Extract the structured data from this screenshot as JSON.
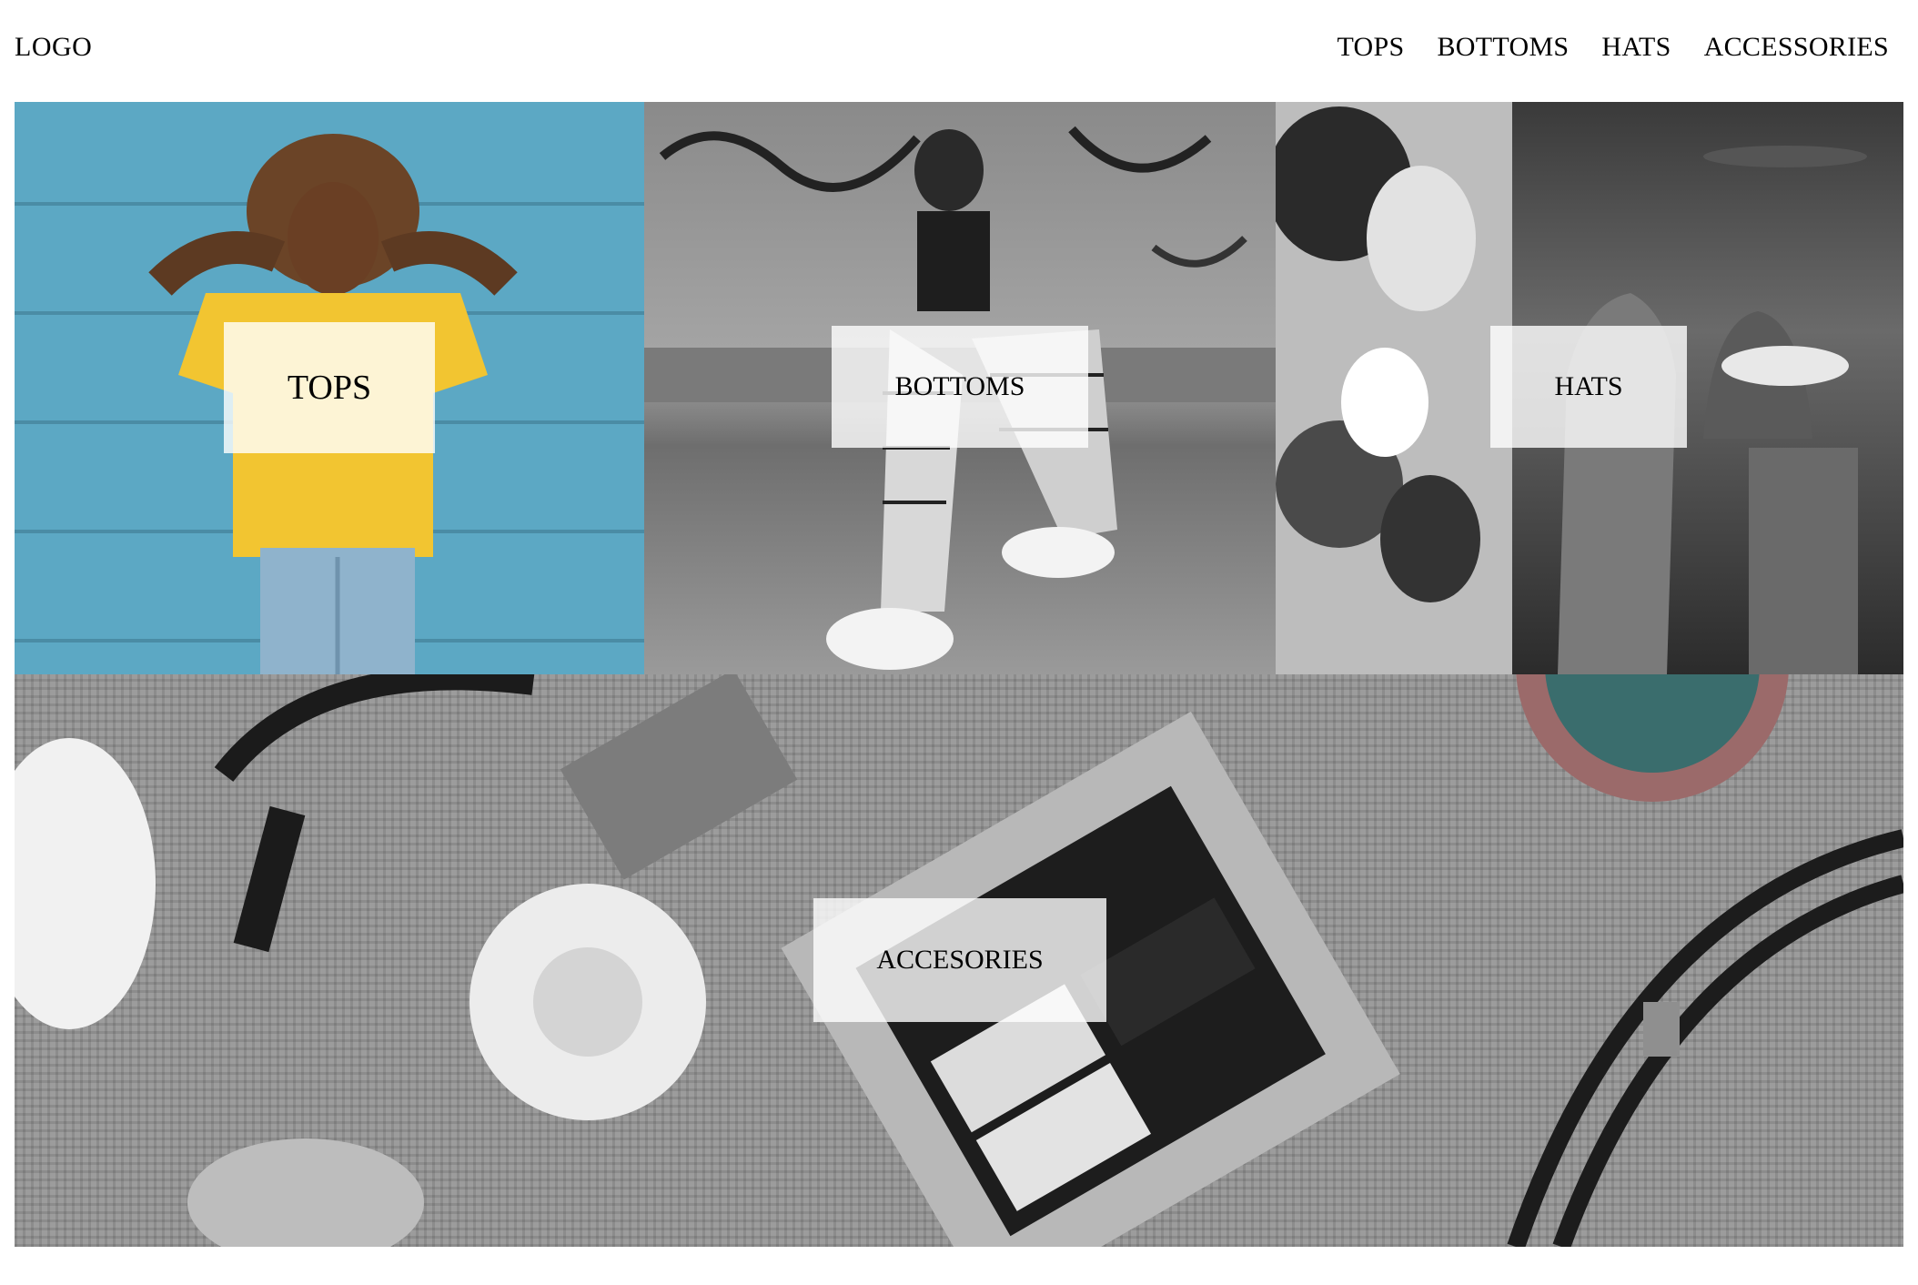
{
  "header": {
    "logo": "LOGO",
    "nav": [
      "TOPS",
      "BOTTOMS",
      "HATS",
      "ACCESSORIES"
    ]
  },
  "tiles": {
    "tops": {
      "label": "TOPS",
      "image": "woman-yellow-tshirt-blue-wall"
    },
    "bottoms": {
      "label": "BOTTOMS",
      "image": "woman-plaid-pants-graffiti-wall"
    },
    "hats": {
      "label": "HATS",
      "image": "hat-shop-wall"
    },
    "accessories": {
      "label": "ACCESORIES",
      "image": "lipgloss-sunglasses-flatlay"
    }
  },
  "colors": {
    "label_background": "#ffffffcc",
    "text": "#000000",
    "tops_wall": "#5ca8c4",
    "tops_shirt": "#f2c531"
  }
}
